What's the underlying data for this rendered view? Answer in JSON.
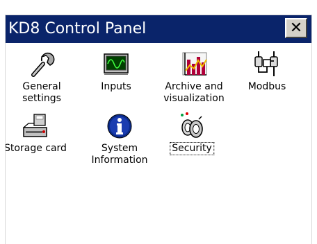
{
  "window": {
    "title": "KD8 Control Panel",
    "close_label": "✕"
  },
  "items": [
    {
      "label": "General\nsettings",
      "icon": "wrench-icon"
    },
    {
      "label": "Inputs",
      "icon": "monitor-waveform-icon"
    },
    {
      "label": "Archive and\nvisualization",
      "icon": "archive-chart-icon"
    },
    {
      "label": "Modbus",
      "icon": "modbus-connector-icon"
    },
    {
      "label": "Storage card",
      "icon": "storage-card-icon"
    },
    {
      "label": "System\nInformation",
      "icon": "info-icon"
    },
    {
      "label": "Security",
      "icon": "security-keys-icon",
      "selected": true
    }
  ],
  "colors": {
    "titlebar": "#0a246a",
    "title_text": "#ffffff",
    "button_face": "#d4d0c8"
  }
}
